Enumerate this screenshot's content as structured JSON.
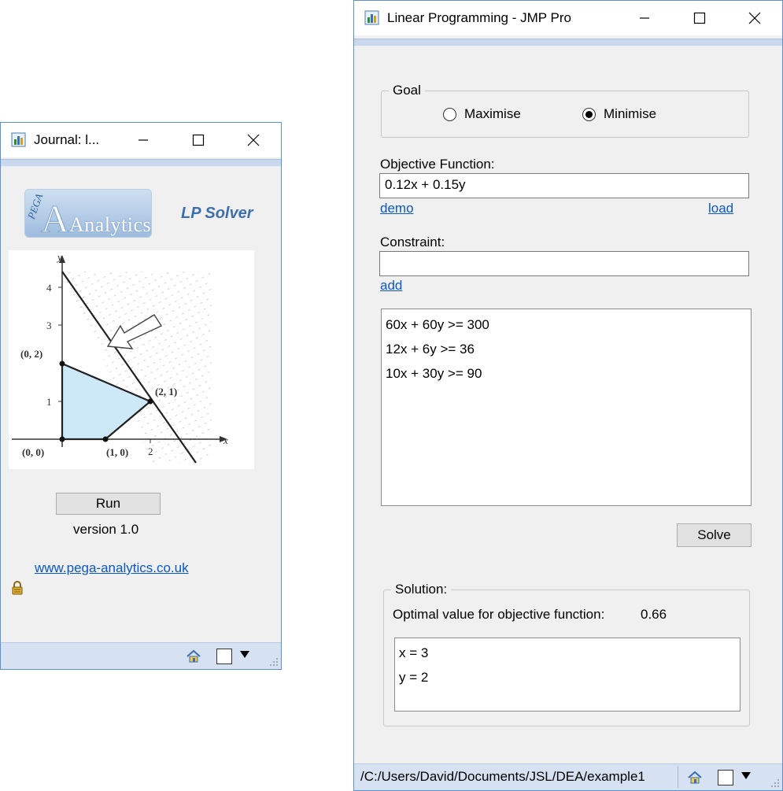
{
  "journal_window": {
    "title": "Journal: l...",
    "logo_text": "Analytics",
    "product_name": "LP Solver",
    "run_label": "Run",
    "version": "version 1.0",
    "website": "www.pega-analytics.co.uk"
  },
  "graph": {
    "y_axis_label": "y",
    "x_axis_label": "x",
    "y_ticks": [
      "4",
      "3",
      "1"
    ],
    "x_tick": "2",
    "points": {
      "p02": "(0, 2)",
      "p21": "(2, 1)",
      "p00": "(0, 0)",
      "p10": "(1, 0)"
    }
  },
  "lp_window": {
    "title": "Linear Programming - JMP Pro",
    "goal_legend": "Goal",
    "goal_options": [
      "Maximise",
      "Minimise"
    ],
    "goal_selected": "Minimise",
    "objective_label": "Objective Function:",
    "objective_value": "0.12x + 0.15y",
    "demo_link": "demo",
    "load_link": "load",
    "constraint_label": "Constraint:",
    "constraint_value": "",
    "add_link": "add",
    "constraints": [
      "60x + 60y >= 300",
      "12x + 6y >= 36",
      "10x + 30y >= 90"
    ],
    "solve_label": "Solve",
    "solution_legend": "Solution:",
    "optimal_label": "Optimal value for objective function:",
    "optimal_value": "0.66",
    "solution_vars": [
      "x = 3",
      "y = 2"
    ],
    "status_path": "/C:/Users/David/Documents/JSL/DEA/example1"
  },
  "colors": {
    "window_border": "#5b8fd6",
    "link": "#0b57c5",
    "feasible_region": "#cde8f7",
    "product_name": "#3d6fae"
  }
}
